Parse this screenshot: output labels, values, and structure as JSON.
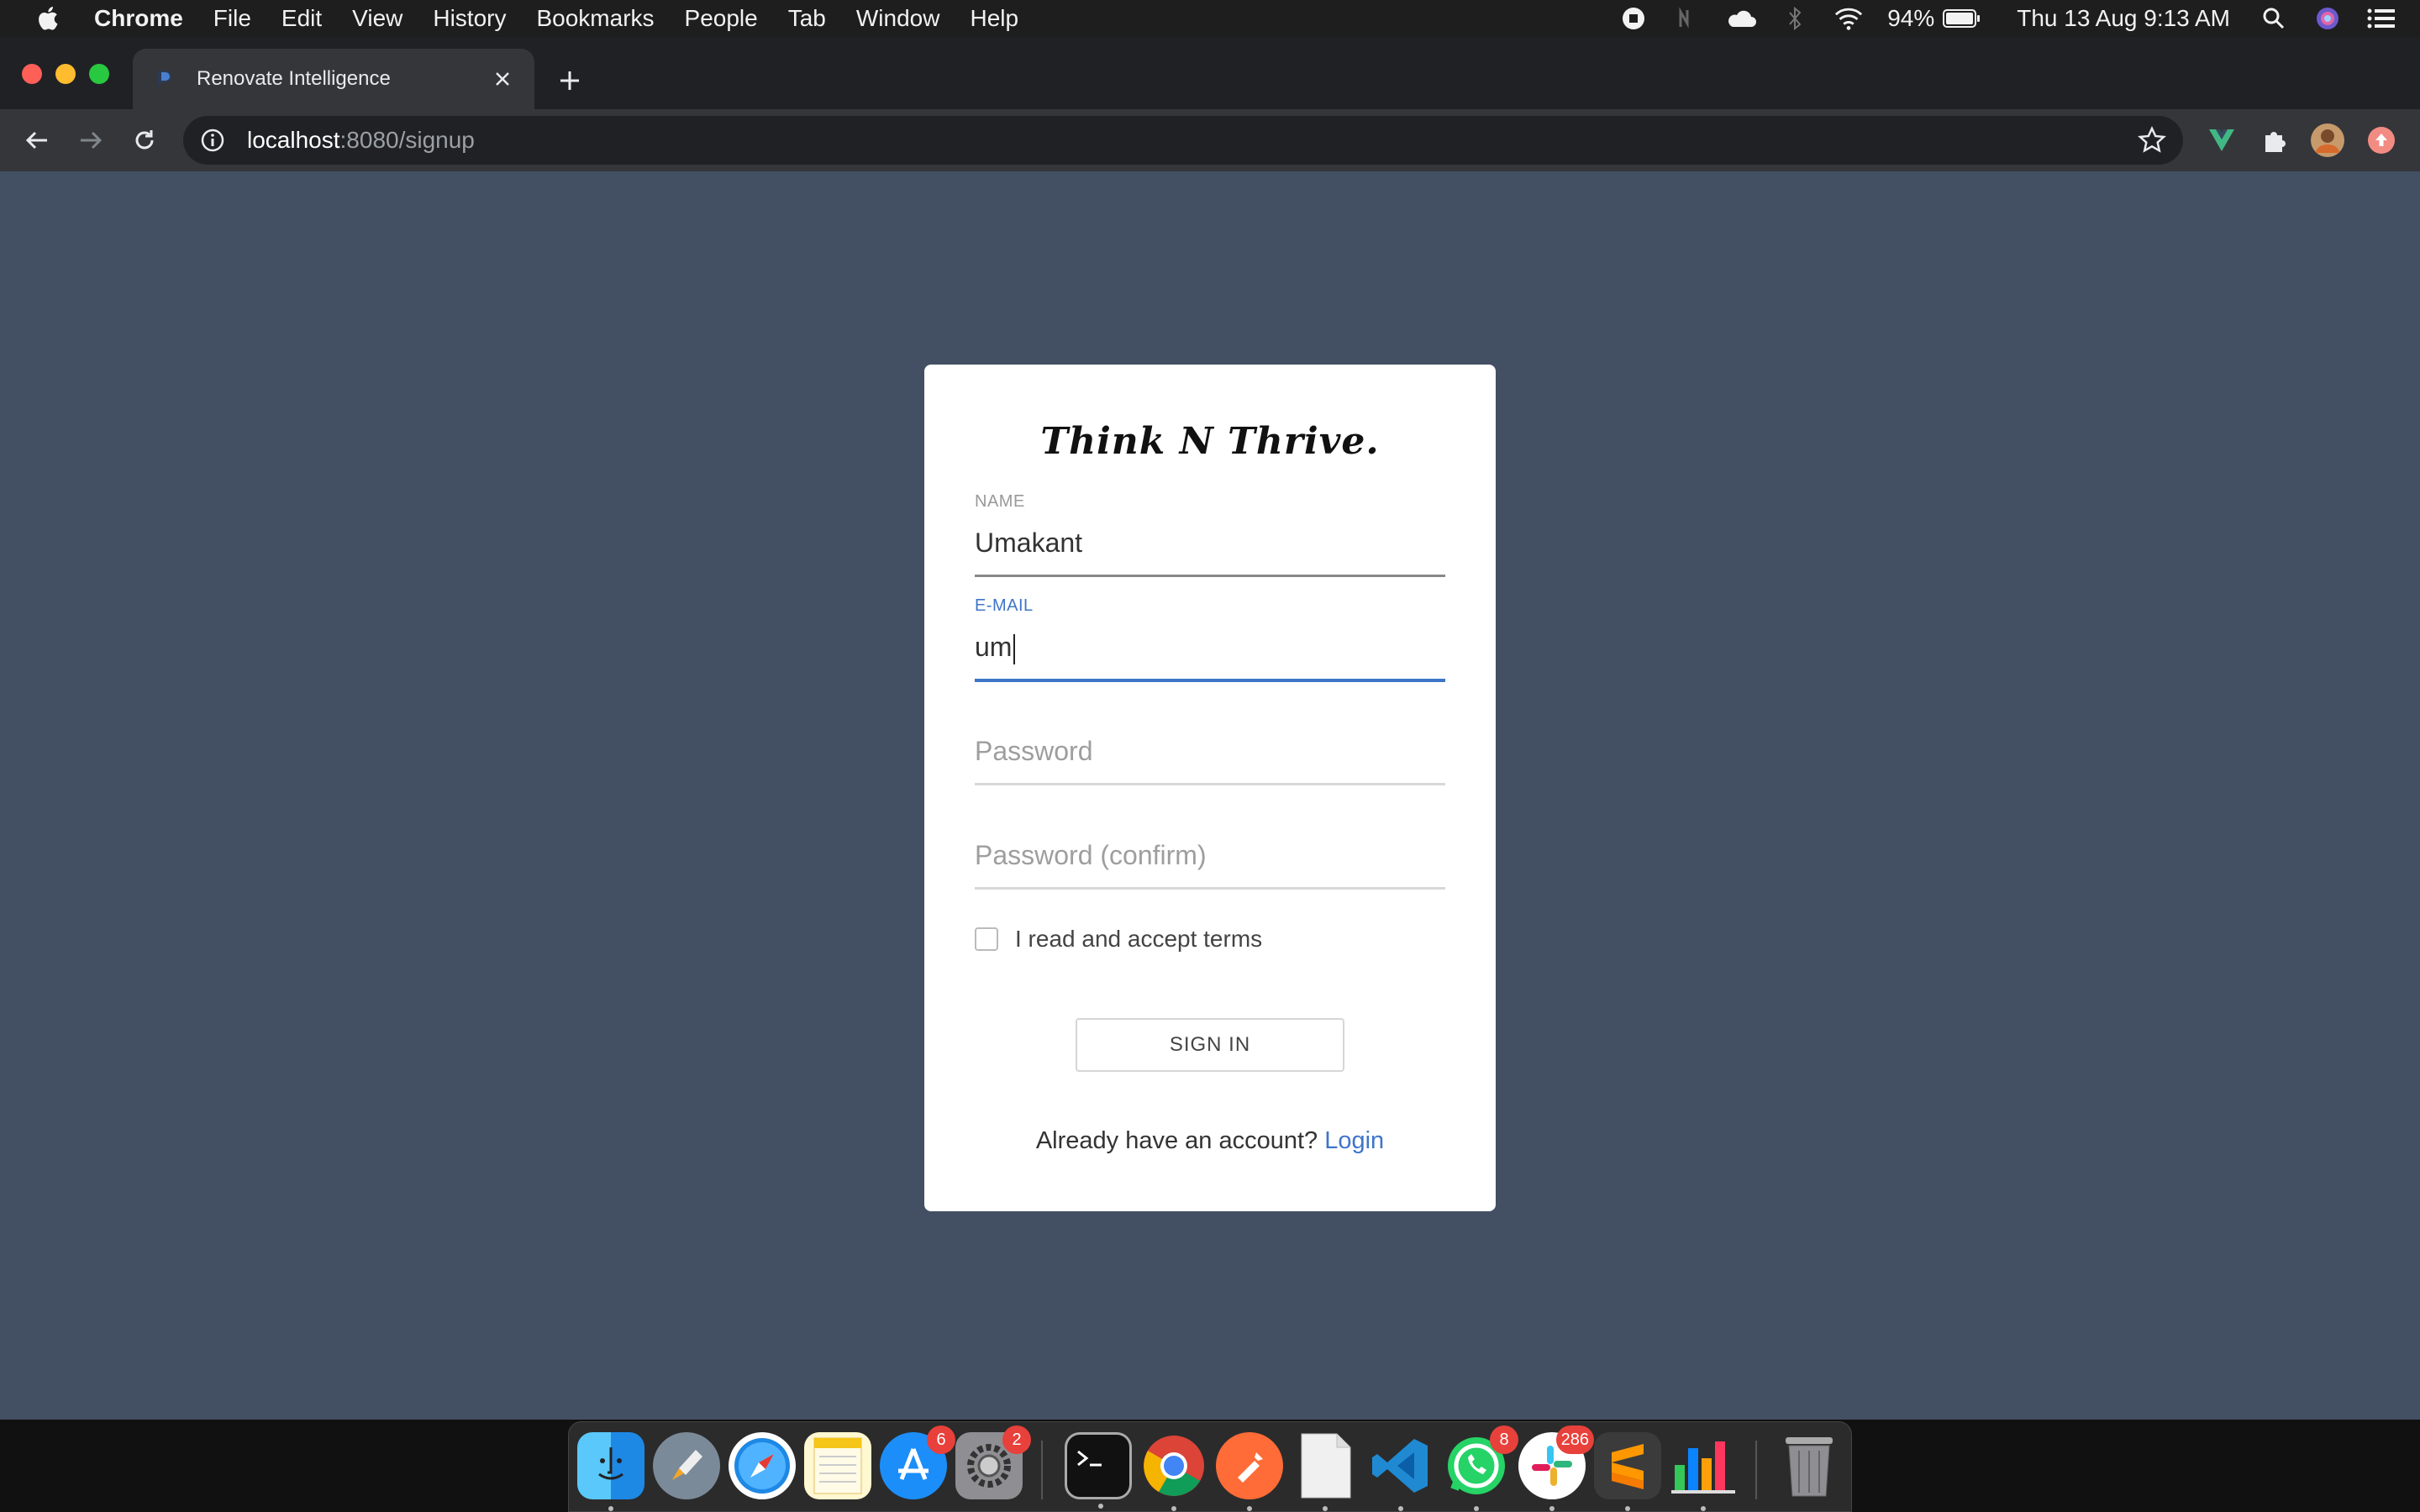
{
  "menubar": {
    "app_name": "Chrome",
    "items": [
      "File",
      "Edit",
      "View",
      "History",
      "Bookmarks",
      "People",
      "Tab",
      "Window",
      "Help"
    ],
    "battery": "94%",
    "datetime": "Thu 13 Aug  9:13 AM"
  },
  "browser": {
    "tab_title": "Renovate Intelligence",
    "url_host": "localhost",
    "url_rest": ":8080/signup"
  },
  "page": {
    "brand": "Think N Thrive.",
    "name_label": "NAME",
    "name_value": "Umakant",
    "email_label": "E-MAIL",
    "email_value": "um",
    "password_placeholder": "Password",
    "password_confirm_placeholder": "Password (confirm)",
    "terms_label": "I read and accept terms",
    "terms_checked": false,
    "signin_label": "SIGN IN",
    "already_text": "Already have an account?",
    "login_link": "Login"
  },
  "dock": {
    "apps": [
      {
        "name": "Finder",
        "badge": ""
      },
      {
        "name": "Launchpad",
        "badge": ""
      },
      {
        "name": "Safari",
        "badge": ""
      },
      {
        "name": "Notes",
        "badge": ""
      },
      {
        "name": "App Store",
        "badge": "6"
      },
      {
        "name": "System Preferences",
        "badge": "2"
      },
      {
        "name": "Terminal",
        "badge": ""
      },
      {
        "name": "Google Chrome",
        "badge": ""
      },
      {
        "name": "Postman",
        "badge": ""
      },
      {
        "name": "File",
        "badge": ""
      },
      {
        "name": "Visual Studio Code",
        "badge": ""
      },
      {
        "name": "WhatsApp",
        "badge": "8"
      },
      {
        "name": "Slack",
        "badge": "286"
      },
      {
        "name": "Sublime Text",
        "badge": ""
      },
      {
        "name": "Numbers",
        "badge": ""
      },
      {
        "name": "Trash",
        "badge": ""
      }
    ]
  },
  "colors": {
    "page_bg": "#434f62",
    "accent": "#3f75c8",
    "badge": "#e8403a"
  }
}
